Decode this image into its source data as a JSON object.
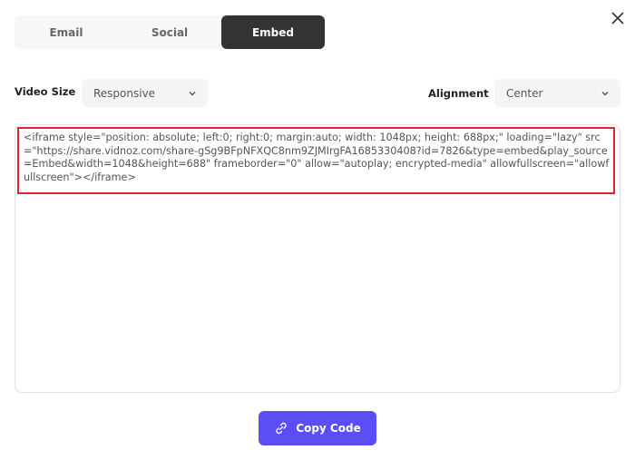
{
  "tabs": [
    {
      "label": "Email",
      "active": false
    },
    {
      "label": "Social",
      "active": false
    },
    {
      "label": "Embed",
      "active": true
    }
  ],
  "close_icon": "close-icon",
  "video_size": {
    "label": "Video Size",
    "value": "Responsive"
  },
  "alignment": {
    "label": "Alignment",
    "value": "Center"
  },
  "embed_code": "<iframe style=\"position: absolute; left:0; right:0; margin:auto; width: 1048px; height: 688px;\" loading=\"lazy\" src=\"https://share.vidnoz.com/share-gSg9BFpNFXQC8nm9ZJMIrgFA1685330408?id=7826&type=embed&play_source=Embed&width=1048&height=688\" frameborder=\"0\" allow=\"autoplay; encrypted-media\" allowfullscreen=\"allowfullscreen\"></iframe>",
  "copy_button": {
    "label": "Copy Code",
    "icon": "link-icon"
  },
  "colors": {
    "accent": "#5b4ef5",
    "active_tab": "#333333",
    "highlight": "#e0272f"
  }
}
